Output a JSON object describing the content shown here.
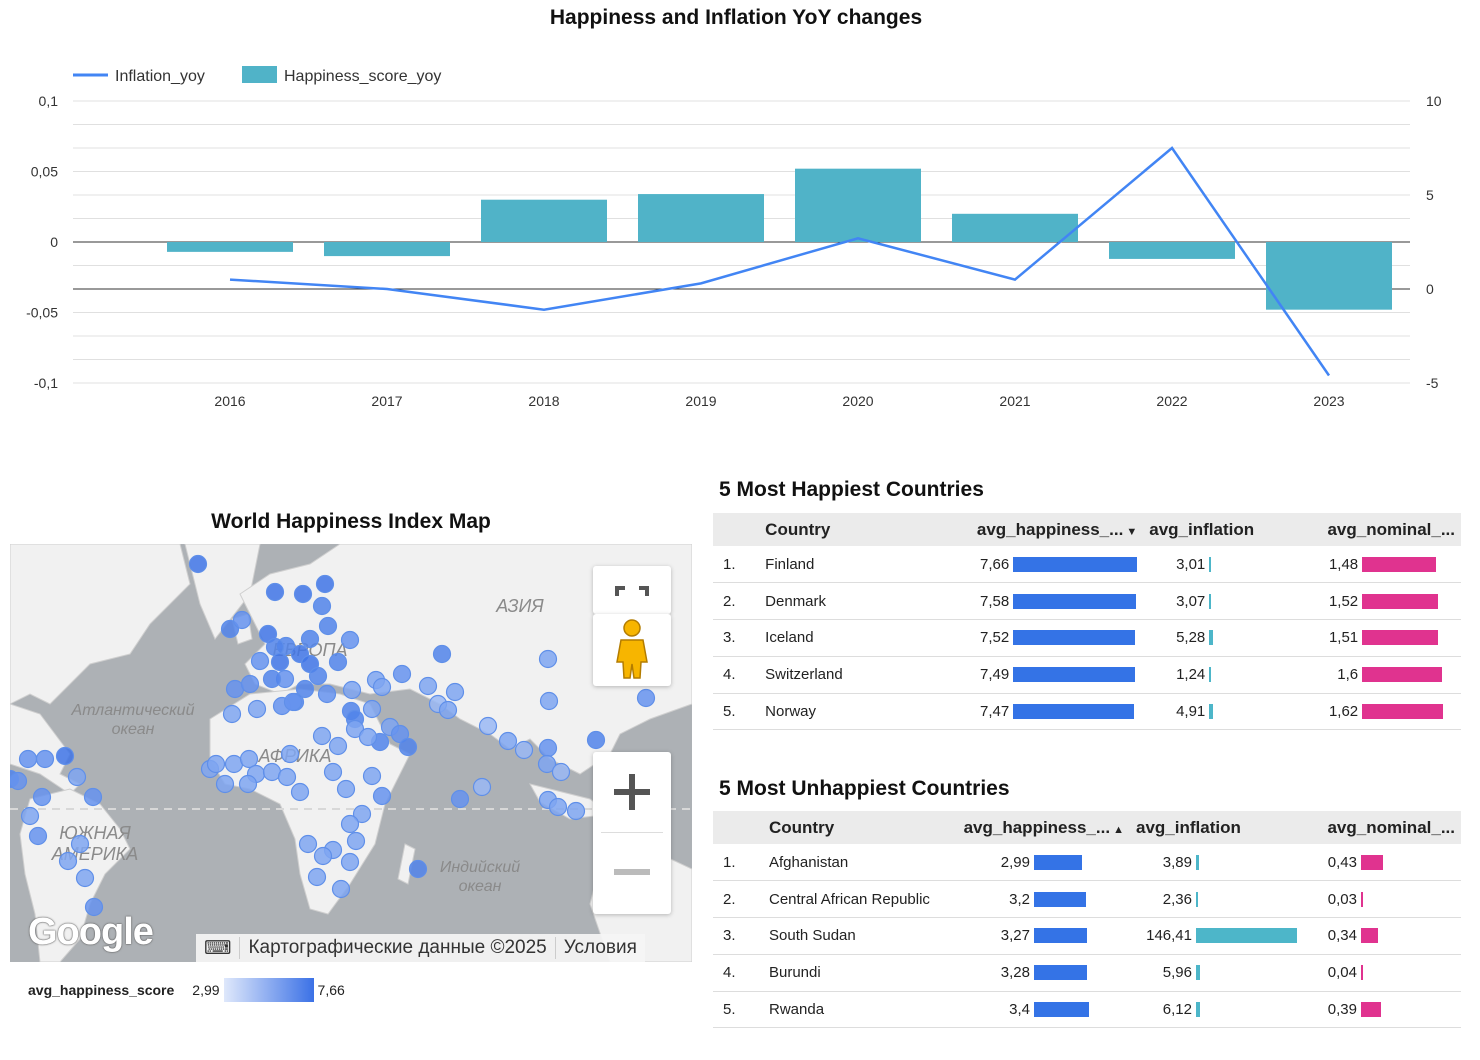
{
  "combo": {
    "title": "Happiness and Inflation YoY changes",
    "legend": [
      {
        "name": "Inflation_yoy",
        "color": "#4285f4"
      },
      {
        "name": "Happiness_score_yoy",
        "color": "#50b3c8"
      }
    ],
    "left_ticks": [
      "0,1",
      "0,05",
      "0",
      "-0,05",
      "-0,1"
    ],
    "right_ticks": [
      "10",
      "5",
      "0",
      "-5"
    ]
  },
  "chart_data": {
    "type": "bar",
    "title": "Happiness and Inflation YoY changes",
    "categories": [
      "2016",
      "2017",
      "2018",
      "2019",
      "2020",
      "2021",
      "2022",
      "2023"
    ],
    "series": [
      {
        "name": "Happiness_score_yoy",
        "type": "bar",
        "axis": "left",
        "values": [
          -0.007,
          -0.01,
          0.03,
          0.034,
          0.052,
          0.02,
          -0.012,
          -0.048
        ]
      },
      {
        "name": "Inflation_yoy",
        "type": "line",
        "axis": "right",
        "values": [
          0.5,
          0.0,
          -1.1,
          0.3,
          2.7,
          0.5,
          7.5,
          -4.6
        ]
      }
    ],
    "ylim_left": [
      -0.1,
      0.1
    ],
    "ylim_right": [
      -5,
      10
    ],
    "grid": true,
    "legend_position": "top-left"
  },
  "map": {
    "title": "World Happiness Index Map",
    "labels": {
      "asia": "АЗИЯ",
      "europe": "ЕВРОПА",
      "africa": "АФРИКА",
      "atlantic": "Атлантический\nокеан",
      "south_america": "ЮЖНАЯ\nАМЕРИКА",
      "indian": "Индийский\nокеан"
    },
    "attribution": "Картографические данные ©2025",
    "terms": "Условия",
    "logo": "Google",
    "legend_label": "avg_happiness_score",
    "legend_min": "2,99",
    "legend_max": "7,66",
    "accent": "#4285f4"
  },
  "happiest": {
    "title": "5 Most Happiest Countries",
    "columns": [
      "Country",
      "avg_happiness_...",
      "avg_inflation",
      "avg_nominal_..."
    ],
    "rows": [
      {
        "rank": "1.",
        "country": "Finland",
        "happiness": "7,66",
        "h": 7.66,
        "inflation": "3,01",
        "i": 3.01,
        "nominal": "1,48",
        "n": 1.48
      },
      {
        "rank": "2.",
        "country": "Denmark",
        "happiness": "7,58",
        "h": 7.58,
        "inflation": "3,07",
        "i": 3.07,
        "nominal": "1,52",
        "n": 1.52
      },
      {
        "rank": "3.",
        "country": "Iceland",
        "happiness": "7,52",
        "h": 7.52,
        "inflation": "5,28",
        "i": 5.28,
        "nominal": "1,51",
        "n": 1.51
      },
      {
        "rank": "4.",
        "country": "Switzerland",
        "happiness": "7,49",
        "h": 7.49,
        "inflation": "1,24",
        "i": 1.24,
        "nominal": "1,6",
        "n": 1.6
      },
      {
        "rank": "5.",
        "country": "Norway",
        "happiness": "7,47",
        "h": 7.47,
        "inflation": "4,91",
        "i": 4.91,
        "nominal": "1,62",
        "n": 1.62
      }
    ]
  },
  "unhappiest": {
    "title": "5 Most Unhappiest Countries",
    "columns": [
      "Country",
      "avg_happiness_...",
      "avg_inflation",
      "avg_nominal_..."
    ],
    "rows": [
      {
        "rank": "1.",
        "country": "Afghanistan",
        "happiness": "2,99",
        "h": 2.99,
        "inflation": "3,89",
        "i": 3.89,
        "nominal": "0,43",
        "n": 0.43
      },
      {
        "rank": "2.",
        "country": "Central African Republic",
        "happiness": "3,2",
        "h": 3.2,
        "inflation": "2,36",
        "i": 2.36,
        "nominal": "0,03",
        "n": 0.03
      },
      {
        "rank": "3.",
        "country": "South Sudan",
        "happiness": "3,27",
        "h": 3.27,
        "inflation": "146,41",
        "i": 146.41,
        "nominal": "0,34",
        "n": 0.34
      },
      {
        "rank": "4.",
        "country": "Burundi",
        "happiness": "3,28",
        "h": 3.28,
        "inflation": "5,96",
        "i": 5.96,
        "nominal": "0,04",
        "n": 0.04
      },
      {
        "rank": "5.",
        "country": "Rwanda",
        "happiness": "3,4",
        "h": 3.4,
        "inflation": "6,12",
        "i": 6.12,
        "nominal": "0,39",
        "n": 0.39
      }
    ]
  },
  "bar_colors": {
    "happiness": "#3473e6",
    "inflation": "#4db6c9",
    "nominal": "#e0338f"
  }
}
